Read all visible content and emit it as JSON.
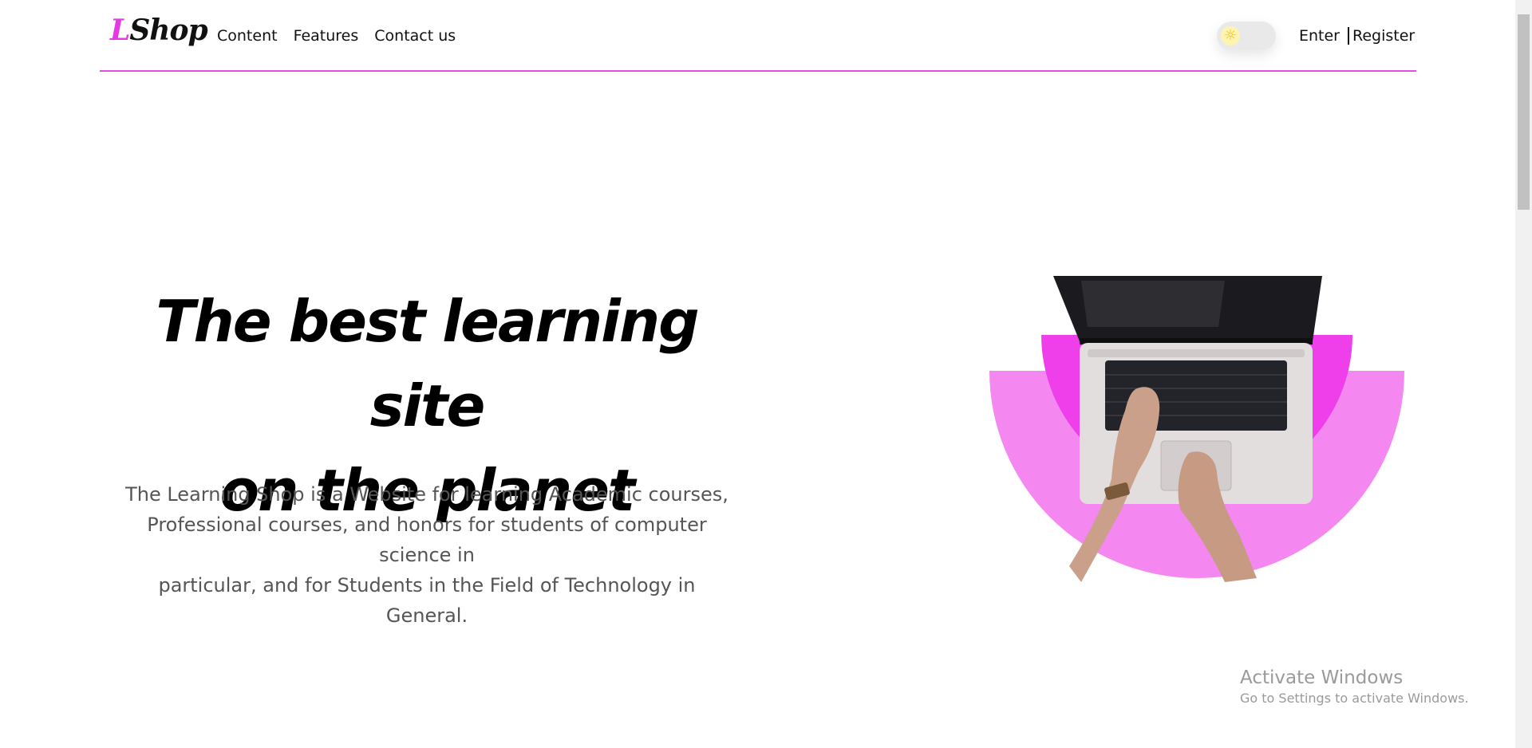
{
  "header": {
    "logo": {
      "l": "L",
      "rest": "Shop"
    },
    "nav": [
      {
        "label": "Content"
      },
      {
        "label": "Features"
      },
      {
        "label": "Contact us"
      }
    ],
    "theme_toggle": {
      "icon": "sun-icon",
      "state": "light"
    },
    "auth": {
      "enter_label": "Enter",
      "register_label": "Register"
    }
  },
  "hero": {
    "title_line1": "The best learning site",
    "title_line2": "on the planet",
    "description_line1": "The Learning Shop is a Website for learning Academic courses,",
    "description_line2": "Professional courses, and honors for students of computer science in",
    "description_line3": "particular, and for Students in the Field of Technology in General."
  },
  "watermark": {
    "title": "Activate Windows",
    "subtitle": "Go to Settings to activate Windows."
  },
  "colors": {
    "accent": "#e639e6",
    "accent_light": "#f487f0",
    "text": "#111111",
    "muted": "#555555"
  }
}
